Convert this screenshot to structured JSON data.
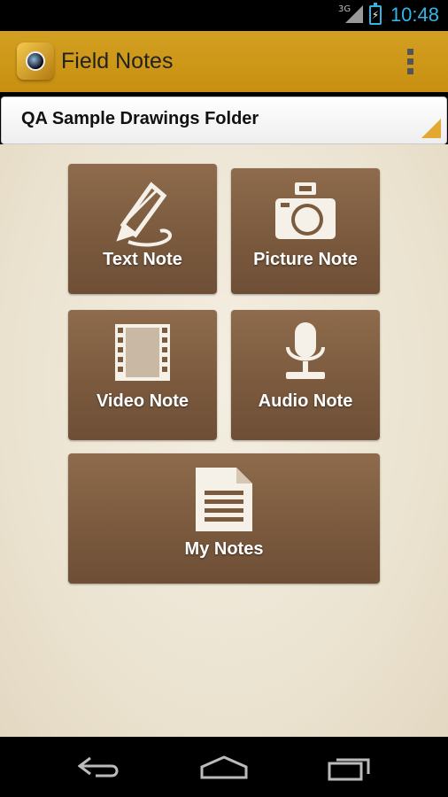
{
  "status_bar": {
    "network": "3G",
    "time": "10:48"
  },
  "app": {
    "title": "Field Notes",
    "icon": "camera-icon"
  },
  "folder_spinner": {
    "selected": "QA Sample Drawings Folder"
  },
  "tiles": {
    "text_note": {
      "label": "Text Note",
      "icon": "pencil-icon"
    },
    "picture_note": {
      "label": "Picture Note",
      "icon": "camera-icon"
    },
    "video_note": {
      "label": "Video Note",
      "icon": "film-icon"
    },
    "audio_note": {
      "label": "Audio Note",
      "icon": "microphone-icon"
    },
    "my_notes": {
      "label": "My Notes",
      "icon": "document-icon"
    }
  },
  "navigation": {
    "icons": [
      "back-icon",
      "home-icon",
      "recent-apps-icon"
    ]
  },
  "colors": {
    "action_bar": "#c88f10",
    "accent": "#33b5e5",
    "tile": "#7b5a3e"
  }
}
